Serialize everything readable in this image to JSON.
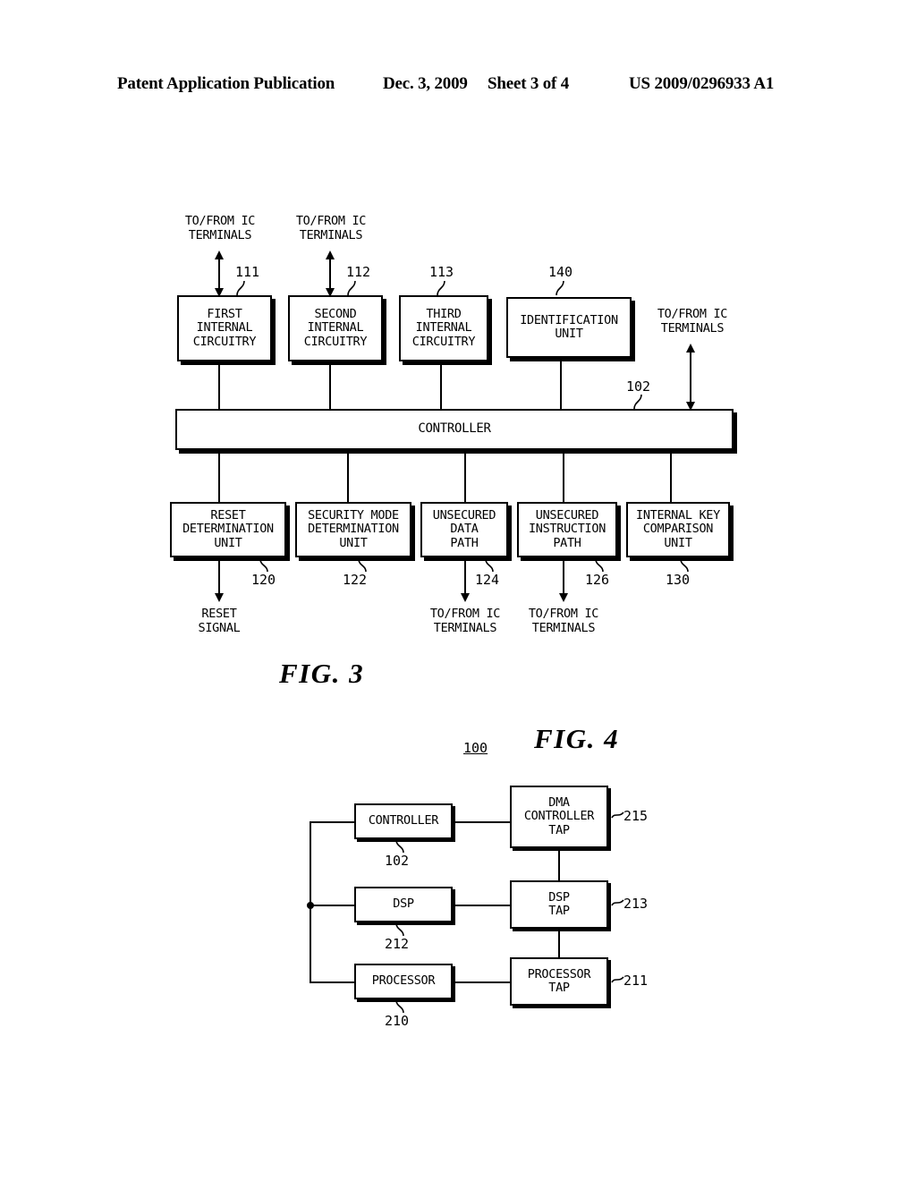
{
  "header": {
    "publication": "Patent Application Publication",
    "date": "Dec. 3, 2009",
    "sheet": "Sheet 3 of 4",
    "patent_number": "US 2009/0296933 A1"
  },
  "figures": [
    {
      "caption": "FIG. 3",
      "top_terminal_labels": [
        "TO/FROM IC\nTERMINALS",
        "TO/FROM IC\nTERMINALS"
      ],
      "right_terminal_label": "TO/FROM IC\nTERMINALS",
      "top_boxes": [
        {
          "label": "FIRST\nINTERNAL\nCIRCUITRY",
          "ref": "111"
        },
        {
          "label": "SECOND\nINTERNAL\nCIRCUITRY",
          "ref": "112"
        },
        {
          "label": "THIRD\nINTERNAL\nCIRCUITRY",
          "ref": "113"
        },
        {
          "label": "IDENTIFICATION\nUNIT",
          "ref": "140"
        }
      ],
      "controller": {
        "label": "CONTROLLER",
        "ref": "102"
      },
      "bottom_boxes": [
        {
          "label": "RESET\nDETERMINATION\nUNIT",
          "ref": "120"
        },
        {
          "label": "SECURITY MODE\nDETERMINATION\nUNIT",
          "ref": "122"
        },
        {
          "label": "UNSECURED\nDATA\nPATH",
          "ref": "124"
        },
        {
          "label": "UNSECURED\nINSTRUCTION\nPATH",
          "ref": "126"
        },
        {
          "label": "INTERNAL KEY\nCOMPARISON\nUNIT",
          "ref": "130"
        }
      ],
      "bottom_labels": [
        "RESET\nSIGNAL",
        "TO/FROM IC\nTERMINALS",
        "TO/FROM IC\nTERMINALS"
      ]
    },
    {
      "caption": "FIG. 4",
      "system_ref": "100",
      "left_boxes": [
        {
          "label": "CONTROLLER",
          "ref": "102"
        },
        {
          "label": "DSP",
          "ref": "212"
        },
        {
          "label": "PROCESSOR",
          "ref": "210"
        }
      ],
      "right_boxes": [
        {
          "label": "DMA\nCONTROLLER\nTAP",
          "ref": "215"
        },
        {
          "label": "DSP\nTAP",
          "ref": "213"
        },
        {
          "label": "PROCESSOR\nTAP",
          "ref": "211"
        }
      ]
    }
  ]
}
